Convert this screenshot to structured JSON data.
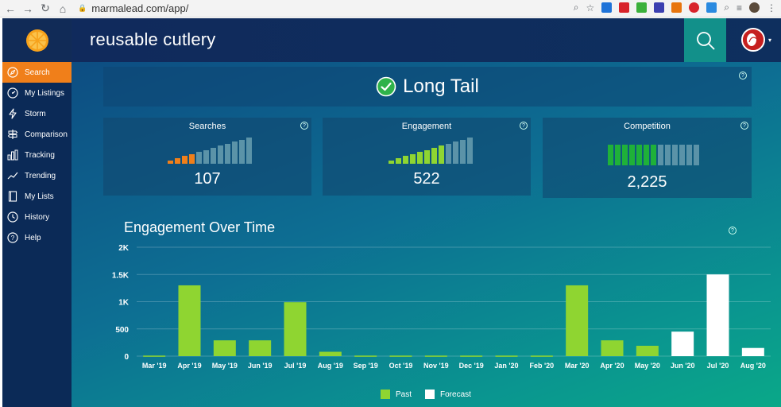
{
  "browser": {
    "url": "marmalead.com/app/"
  },
  "header": {
    "title": "reusable cutlery"
  },
  "sidebar": {
    "items": [
      {
        "label": "Search",
        "icon": "compass-icon",
        "active": true
      },
      {
        "label": "My Listings",
        "icon": "gauge-icon",
        "active": false
      },
      {
        "label": "Storm",
        "icon": "lightning-icon",
        "active": false
      },
      {
        "label": "Comparison",
        "icon": "signpost-icon",
        "active": false
      },
      {
        "label": "Tracking",
        "icon": "bar-chart-icon",
        "active": false
      },
      {
        "label": "Trending",
        "icon": "trend-line-icon",
        "active": false
      },
      {
        "label": "My Lists",
        "icon": "notebook-icon",
        "active": false
      },
      {
        "label": "History",
        "icon": "clock-icon",
        "active": false
      },
      {
        "label": "Help",
        "icon": "question-icon",
        "active": false
      }
    ]
  },
  "banner": {
    "label": "Long Tail"
  },
  "stats": {
    "searches": {
      "label": "Searches",
      "value": "107",
      "filled": 4,
      "total": 12,
      "color": "#f07f1a"
    },
    "engagement": {
      "label": "Engagement",
      "value": "522",
      "filled": 8,
      "total": 12,
      "color": "#8fd531"
    },
    "competition": {
      "label": "Competition",
      "value": "2,225",
      "filled": 7,
      "total": 13,
      "color": "#1fb139"
    }
  },
  "colors": {
    "past": "#8fd531",
    "forecast": "#ffffff",
    "inactive_bar": "#5b93a8"
  },
  "chart_data": {
    "type": "bar",
    "title": "Engagement Over Time",
    "categories": [
      "Mar '19",
      "Apr '19",
      "May '19",
      "Jun '19",
      "Jul '19",
      "Aug '19",
      "Sep '19",
      "Oct '19",
      "Nov '19",
      "Dec '19",
      "Jan '20",
      "Feb '20",
      "Mar '20",
      "Apr '20",
      "May '20",
      "Jun '20",
      "Jul '20",
      "Aug '20"
    ],
    "series": [
      {
        "name": "Past",
        "values": [
          10,
          1300,
          290,
          290,
          990,
          80,
          10,
          10,
          10,
          10,
          10,
          10,
          1300,
          290,
          190,
          null,
          null,
          null
        ]
      },
      {
        "name": "Forecast",
        "values": [
          null,
          null,
          null,
          null,
          null,
          null,
          null,
          null,
          null,
          null,
          null,
          null,
          null,
          null,
          null,
          450,
          1500,
          150
        ]
      }
    ],
    "ytick_labels": [
      "0",
      "500",
      "1K",
      "1.5K",
      "2K"
    ],
    "ytick_values": [
      0,
      500,
      1000,
      1500,
      2000
    ],
    "ylim": [
      0,
      2000
    ],
    "grid": true,
    "legend": "bottom-center"
  }
}
